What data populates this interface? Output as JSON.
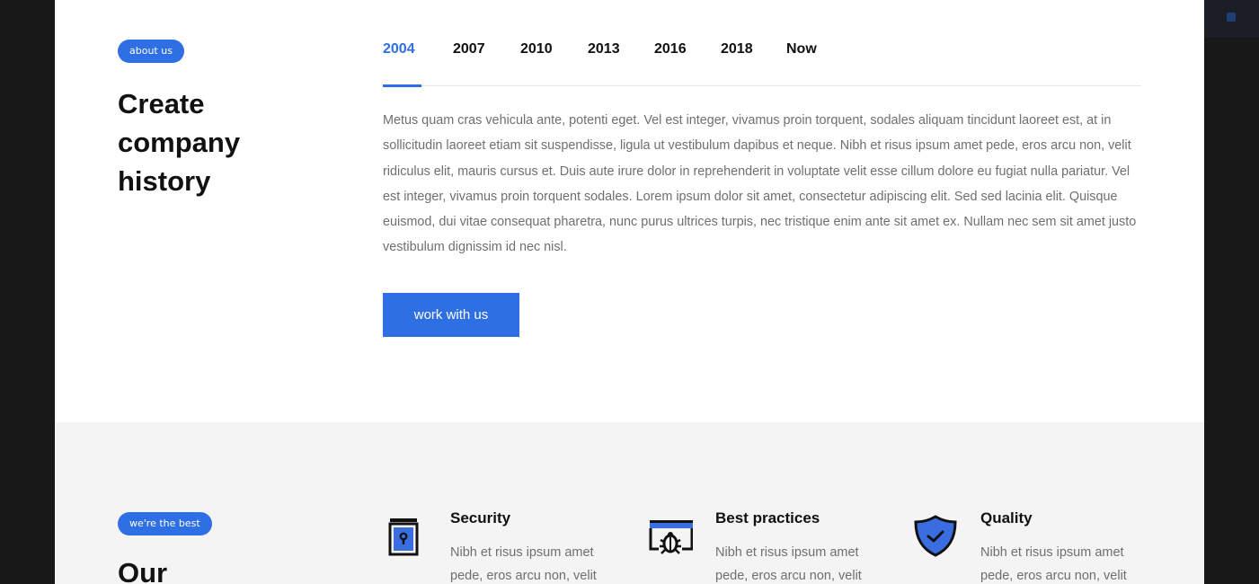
{
  "about": {
    "badge": "about us",
    "heading_lines": [
      "Create",
      "company",
      "history"
    ]
  },
  "timeline": {
    "tabs": [
      {
        "label": "2004",
        "active": true
      },
      {
        "label": "2007",
        "active": false
      },
      {
        "label": "2010",
        "active": false
      },
      {
        "label": "2013",
        "active": false
      },
      {
        "label": "2016",
        "active": false
      },
      {
        "label": "2018",
        "active": false
      },
      {
        "label": "Now",
        "active": false
      }
    ],
    "text": "Metus quam cras vehicula ante, potenti eget. Vel est integer, vivamus proin torquent, sodales aliquam tincidunt laoreet est, at in sollicitudin laoreet etiam sit suspendisse, ligula ut vestibulum dapibus et neque. Nibh et risus ipsum amet pede, eros arcu non, velit ridiculus elit, mauris cursus et. Duis aute irure dolor in reprehenderit in voluptate velit esse cillum dolore eu fugiat nulla pariatur. Vel est integer, vivamus proin torquent sodales. Lorem ipsum dolor sit amet, consectetur adipiscing elit. Sed sed lacinia elit. Quisque euismod, dui vitae consequat pharetra, nunc purus ultrices turpis, nec tristique enim ante sit amet ex. Nullam nec sem sit amet justo vestibulum dignissim id nec nisl.",
    "cta_label": "work with us"
  },
  "best": {
    "badge": "we're the best",
    "heading": "Our",
    "features": [
      {
        "title": "Security",
        "desc": "Nibh et risus ipsum amet pede, eros arcu non, velit",
        "icon": "lock-book-icon"
      },
      {
        "title": "Best practices",
        "desc": "Nibh et risus ipsum amet pede, eros arcu non, velit",
        "icon": "bug-screen-icon"
      },
      {
        "title": "Quality",
        "desc": "Nibh et risus ipsum amet pede, eros arcu non, velit",
        "icon": "shield-check-icon"
      }
    ]
  },
  "colors": {
    "accent": "#2f6fe4",
    "text_dark": "#111111",
    "text_muted": "#6f6f6f",
    "section_bg": "#f4f4f4"
  }
}
